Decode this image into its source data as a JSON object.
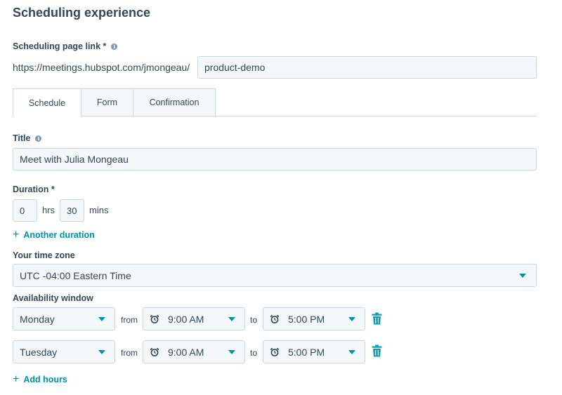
{
  "section_title": "Scheduling experience",
  "page_link": {
    "label": "Scheduling page link *",
    "url_prefix": "https://meetings.hubspot.com/jmongeau/",
    "slug": "product-demo"
  },
  "tabs": [
    {
      "label": "Schedule",
      "active": true
    },
    {
      "label": "Form",
      "active": false
    },
    {
      "label": "Confirmation",
      "active": false
    }
  ],
  "title_field": {
    "label": "Title",
    "value": "Meet with Julia Mongeau"
  },
  "duration": {
    "label": "Duration *",
    "hours": "0",
    "hours_unit": "hrs",
    "minutes": "30",
    "minutes_unit": "mins",
    "add_label": "Another duration"
  },
  "timezone": {
    "label": "Your time zone",
    "value": "UTC -04:00 Eastern Time"
  },
  "availability": {
    "label": "Availability window",
    "from_label": "from",
    "to_label": "to",
    "rows": [
      {
        "day": "Monday",
        "start": "9:00 AM",
        "end": "5:00 PM"
      },
      {
        "day": "Tuesday",
        "start": "9:00 AM",
        "end": "5:00 PM"
      }
    ],
    "add_label": "Add hours"
  },
  "colors": {
    "text": "#33475b",
    "accent": "#0091ae",
    "border": "#cbd6e2",
    "field_bg": "#f5f8fa",
    "trash": "#00a4bd"
  },
  "icons": [
    "info-icon",
    "plus-icon",
    "chevron-down-icon",
    "alarm-clock-icon",
    "trash-icon"
  ]
}
